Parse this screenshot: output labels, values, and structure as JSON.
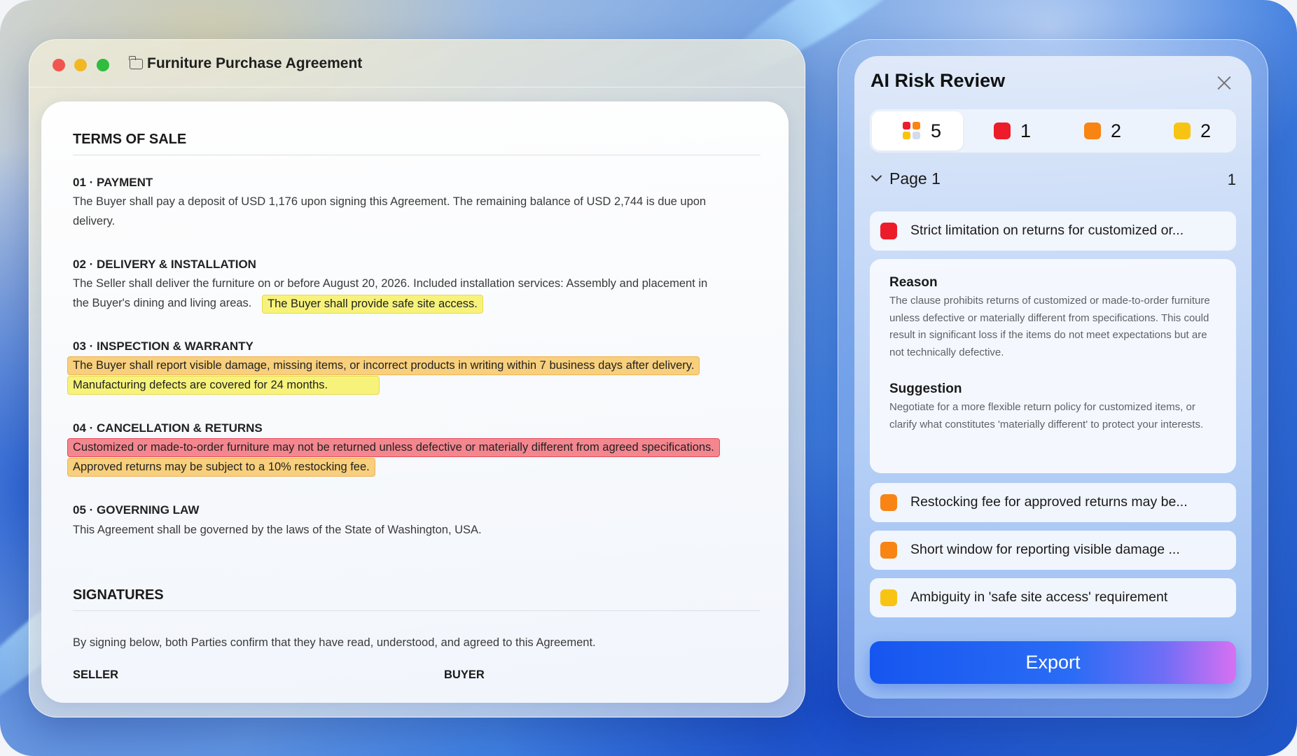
{
  "colors": {
    "high": "#ec1c2b",
    "medium": "#f88414",
    "low": "#f8c414",
    "accent": "#1656f0"
  },
  "document": {
    "window_title": "Furniture Purchase Agreement",
    "section_terms": "TERMS OF SALE",
    "clauses": [
      {
        "heading": "01 · PAYMENT",
        "line1": "The Buyer shall pay a deposit of USD 1,176 upon signing this Agreement. The remaining balance of USD 2,744 is due upon",
        "line2": "delivery."
      },
      {
        "heading": "02 · DELIVERY & INSTALLATION",
        "line1": "The Seller shall deliver the furniture on or before August 20, 2026. Included installation services: Assembly and placement in",
        "line2": "the Buyer's dining and living areas.",
        "highlight": "The Buyer shall provide safe site access."
      },
      {
        "heading": "03 · INSPECTION & WARRANTY",
        "highlight1": "The Buyer shall report visible damage, missing items, or incorrect products in writing within 7 business days after delivery.",
        "highlight2": "Manufacturing defects are covered for 24 months."
      },
      {
        "heading": "04 · CANCELLATION & RETURNS",
        "highlight1": "Customized or made-to-order furniture may not be returned unless defective or materially different from agreed specifications.",
        "highlight2": "Approved returns may be subject to a 10% restocking fee."
      },
      {
        "heading": "05 · GOVERNING LAW",
        "line1": "This Agreement shall be governed by the laws of the State of Washington, USA."
      }
    ],
    "section_signatures": "SIGNATURES",
    "signatures_text": "By signing below, both Parties confirm that they have read, understood, and agreed to this Agreement.",
    "seller_label": "SELLER",
    "buyer_label": "BUYER"
  },
  "review": {
    "title": "AI Risk Review",
    "filters": [
      {
        "icon": "all-risks-icon",
        "count": "5"
      },
      {
        "icon": "high-risk-icon",
        "count": "1"
      },
      {
        "icon": "medium-risk-icon",
        "count": "2"
      },
      {
        "icon": "low-risk-icon",
        "count": "2"
      }
    ],
    "page_group": {
      "label": "Page 1",
      "count": "1"
    },
    "risks": [
      {
        "level": "high",
        "label": "Strict limitation on returns for customized or..."
      },
      {
        "level": "medium",
        "label": "Restocking fee for approved returns may be..."
      },
      {
        "level": "medium",
        "label": "Short window for reporting visible damage ..."
      },
      {
        "level": "low",
        "label": "Ambiguity in 'safe site access' requirement"
      }
    ],
    "detail": {
      "reason_heading": "Reason",
      "reason_text": "The clause prohibits returns of customized or made-to-order furniture unless defective or materially different from specifications. This could result in significant loss if the items do not meet expectations but are not technically defective.",
      "suggestion_heading": "Suggestion",
      "suggestion_text": "Negotiate for a more flexible return policy for customized items, or clarify what constitutes 'materially different' to protect your interests."
    },
    "export_label": "Export"
  }
}
